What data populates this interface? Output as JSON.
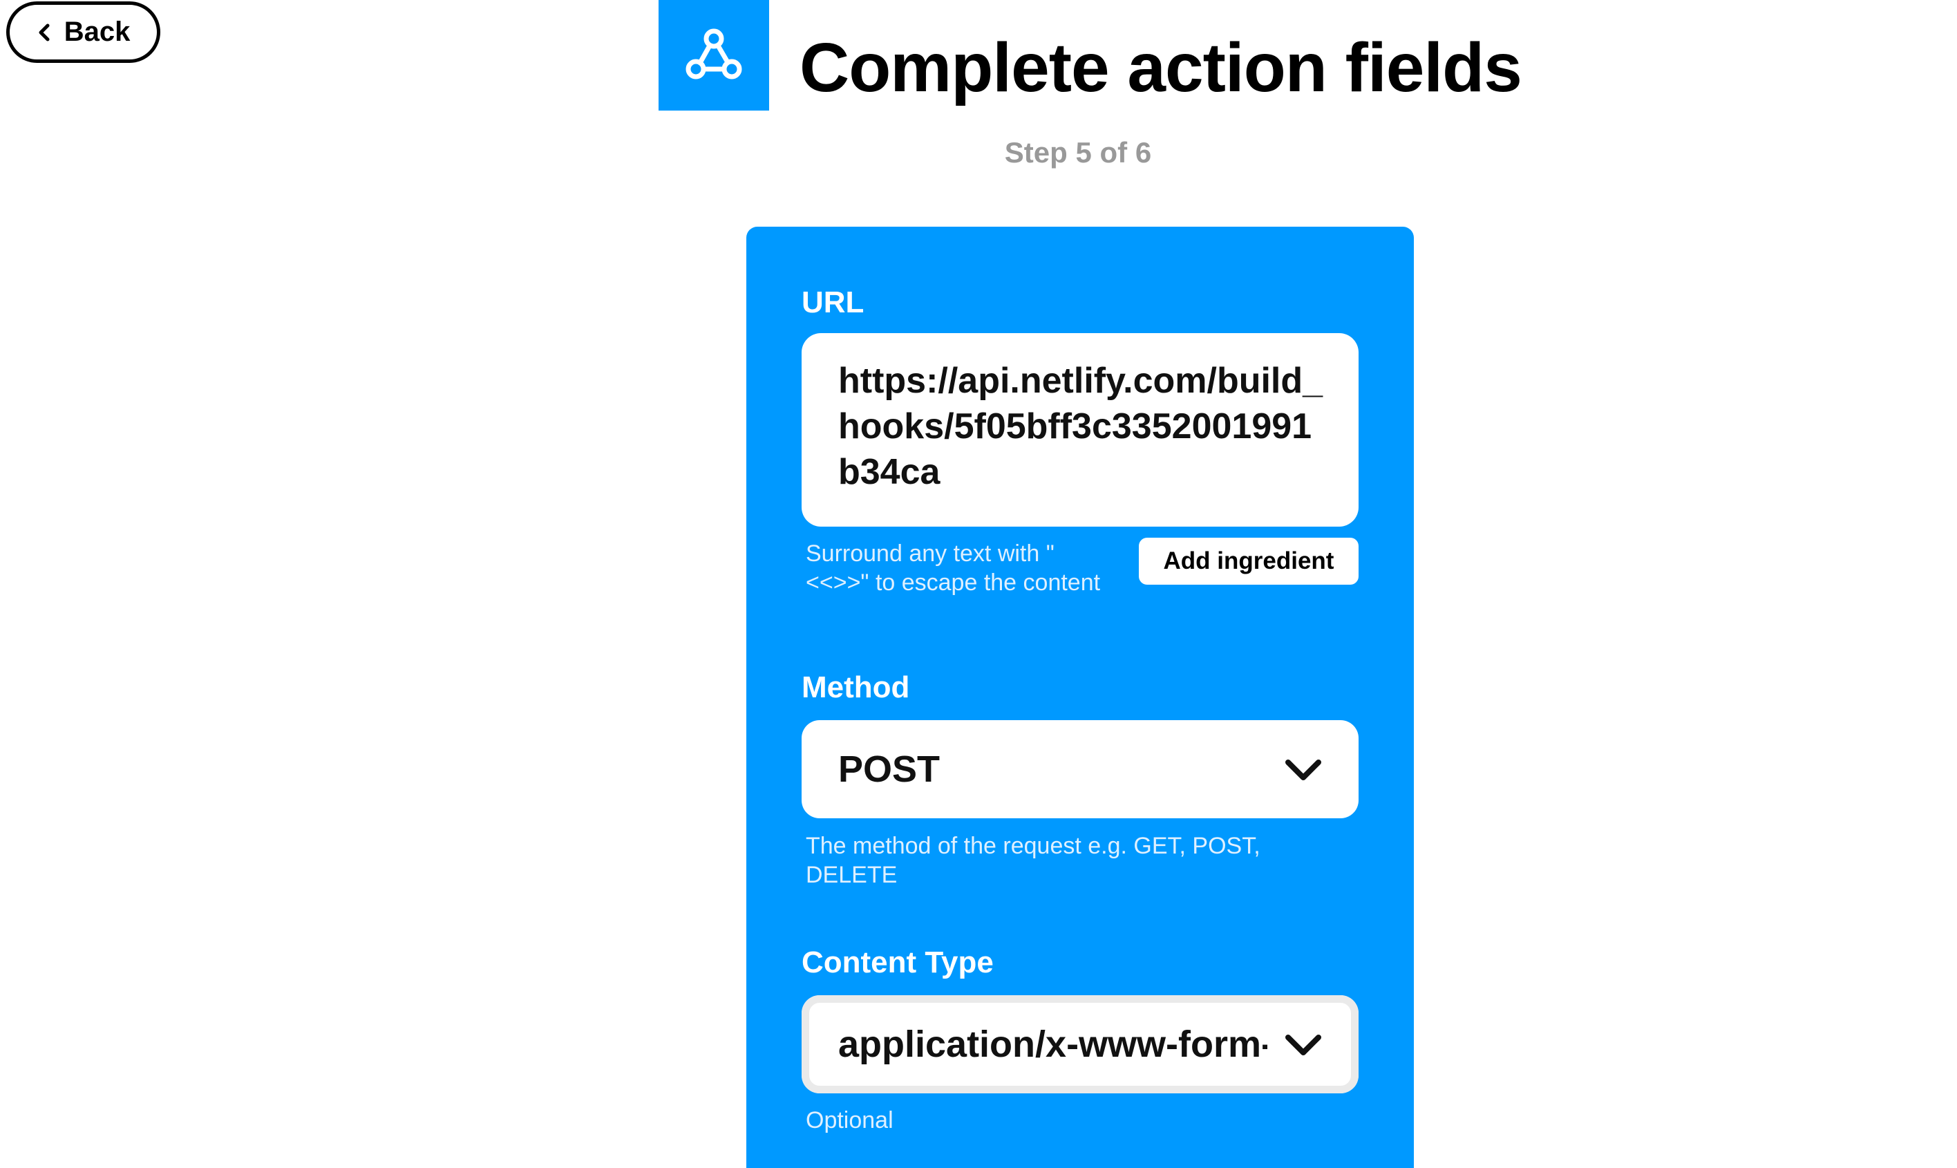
{
  "colors": {
    "accent": "#0099ff"
  },
  "nav": {
    "back_label": "Back",
    "back_icon": "chevron-left-icon"
  },
  "header": {
    "service_icon": "webhooks-icon",
    "title": "Complete action fields",
    "step": "Step 5 of 6"
  },
  "form": {
    "url": {
      "label": "URL",
      "value": "https://api.netlify.com/build_hooks/5f05bff3c3352001991b34ca",
      "hint": "Surround any text with \"<<>>\" to escape the content",
      "add_ingredient_label": "Add ingredient"
    },
    "method": {
      "label": "Method",
      "value": "POST",
      "hint": "The method of the request e.g. GET, POST, DELETE"
    },
    "content_type": {
      "label": "Content Type",
      "value": "application/x-www-form-urlencoded",
      "hint": "Optional"
    }
  }
}
